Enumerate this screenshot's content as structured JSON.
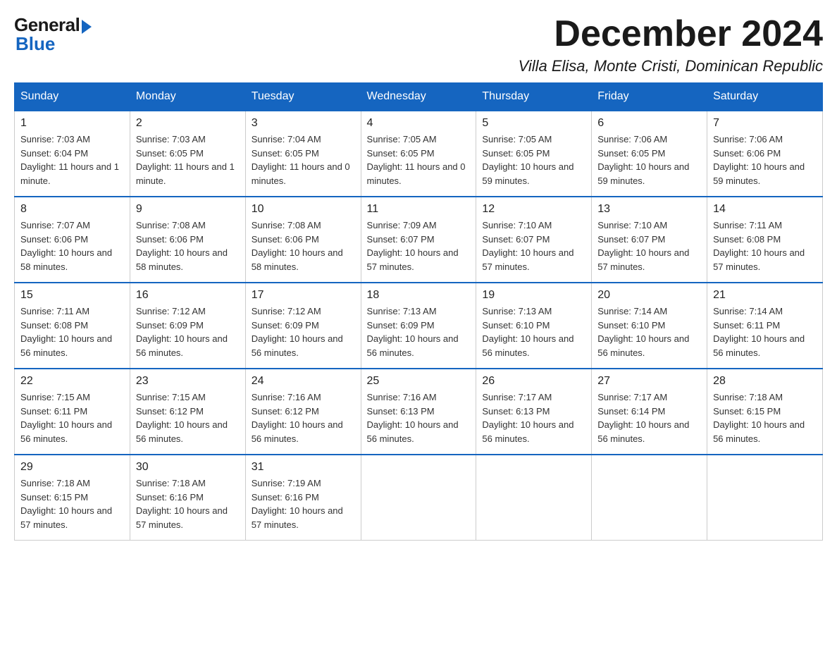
{
  "logo": {
    "general": "General",
    "blue": "Blue"
  },
  "header": {
    "month": "December 2024",
    "location": "Villa Elisa, Monte Cristi, Dominican Republic"
  },
  "days_of_week": [
    "Sunday",
    "Monday",
    "Tuesday",
    "Wednesday",
    "Thursday",
    "Friday",
    "Saturday"
  ],
  "weeks": [
    [
      {
        "day": "1",
        "sunrise": "7:03 AM",
        "sunset": "6:04 PM",
        "daylight": "11 hours and 1 minute."
      },
      {
        "day": "2",
        "sunrise": "7:03 AM",
        "sunset": "6:05 PM",
        "daylight": "11 hours and 1 minute."
      },
      {
        "day": "3",
        "sunrise": "7:04 AM",
        "sunset": "6:05 PM",
        "daylight": "11 hours and 0 minutes."
      },
      {
        "day": "4",
        "sunrise": "7:05 AM",
        "sunset": "6:05 PM",
        "daylight": "11 hours and 0 minutes."
      },
      {
        "day": "5",
        "sunrise": "7:05 AM",
        "sunset": "6:05 PM",
        "daylight": "10 hours and 59 minutes."
      },
      {
        "day": "6",
        "sunrise": "7:06 AM",
        "sunset": "6:05 PM",
        "daylight": "10 hours and 59 minutes."
      },
      {
        "day": "7",
        "sunrise": "7:06 AM",
        "sunset": "6:06 PM",
        "daylight": "10 hours and 59 minutes."
      }
    ],
    [
      {
        "day": "8",
        "sunrise": "7:07 AM",
        "sunset": "6:06 PM",
        "daylight": "10 hours and 58 minutes."
      },
      {
        "day": "9",
        "sunrise": "7:08 AM",
        "sunset": "6:06 PM",
        "daylight": "10 hours and 58 minutes."
      },
      {
        "day": "10",
        "sunrise": "7:08 AM",
        "sunset": "6:06 PM",
        "daylight": "10 hours and 58 minutes."
      },
      {
        "day": "11",
        "sunrise": "7:09 AM",
        "sunset": "6:07 PM",
        "daylight": "10 hours and 57 minutes."
      },
      {
        "day": "12",
        "sunrise": "7:10 AM",
        "sunset": "6:07 PM",
        "daylight": "10 hours and 57 minutes."
      },
      {
        "day": "13",
        "sunrise": "7:10 AM",
        "sunset": "6:07 PM",
        "daylight": "10 hours and 57 minutes."
      },
      {
        "day": "14",
        "sunrise": "7:11 AM",
        "sunset": "6:08 PM",
        "daylight": "10 hours and 57 minutes."
      }
    ],
    [
      {
        "day": "15",
        "sunrise": "7:11 AM",
        "sunset": "6:08 PM",
        "daylight": "10 hours and 56 minutes."
      },
      {
        "day": "16",
        "sunrise": "7:12 AM",
        "sunset": "6:09 PM",
        "daylight": "10 hours and 56 minutes."
      },
      {
        "day": "17",
        "sunrise": "7:12 AM",
        "sunset": "6:09 PM",
        "daylight": "10 hours and 56 minutes."
      },
      {
        "day": "18",
        "sunrise": "7:13 AM",
        "sunset": "6:09 PM",
        "daylight": "10 hours and 56 minutes."
      },
      {
        "day": "19",
        "sunrise": "7:13 AM",
        "sunset": "6:10 PM",
        "daylight": "10 hours and 56 minutes."
      },
      {
        "day": "20",
        "sunrise": "7:14 AM",
        "sunset": "6:10 PM",
        "daylight": "10 hours and 56 minutes."
      },
      {
        "day": "21",
        "sunrise": "7:14 AM",
        "sunset": "6:11 PM",
        "daylight": "10 hours and 56 minutes."
      }
    ],
    [
      {
        "day": "22",
        "sunrise": "7:15 AM",
        "sunset": "6:11 PM",
        "daylight": "10 hours and 56 minutes."
      },
      {
        "day": "23",
        "sunrise": "7:15 AM",
        "sunset": "6:12 PM",
        "daylight": "10 hours and 56 minutes."
      },
      {
        "day": "24",
        "sunrise": "7:16 AM",
        "sunset": "6:12 PM",
        "daylight": "10 hours and 56 minutes."
      },
      {
        "day": "25",
        "sunrise": "7:16 AM",
        "sunset": "6:13 PM",
        "daylight": "10 hours and 56 minutes."
      },
      {
        "day": "26",
        "sunrise": "7:17 AM",
        "sunset": "6:13 PM",
        "daylight": "10 hours and 56 minutes."
      },
      {
        "day": "27",
        "sunrise": "7:17 AM",
        "sunset": "6:14 PM",
        "daylight": "10 hours and 56 minutes."
      },
      {
        "day": "28",
        "sunrise": "7:18 AM",
        "sunset": "6:15 PM",
        "daylight": "10 hours and 56 minutes."
      }
    ],
    [
      {
        "day": "29",
        "sunrise": "7:18 AM",
        "sunset": "6:15 PM",
        "daylight": "10 hours and 57 minutes."
      },
      {
        "day": "30",
        "sunrise": "7:18 AM",
        "sunset": "6:16 PM",
        "daylight": "10 hours and 57 minutes."
      },
      {
        "day": "31",
        "sunrise": "7:19 AM",
        "sunset": "6:16 PM",
        "daylight": "10 hours and 57 minutes."
      },
      null,
      null,
      null,
      null
    ]
  ]
}
